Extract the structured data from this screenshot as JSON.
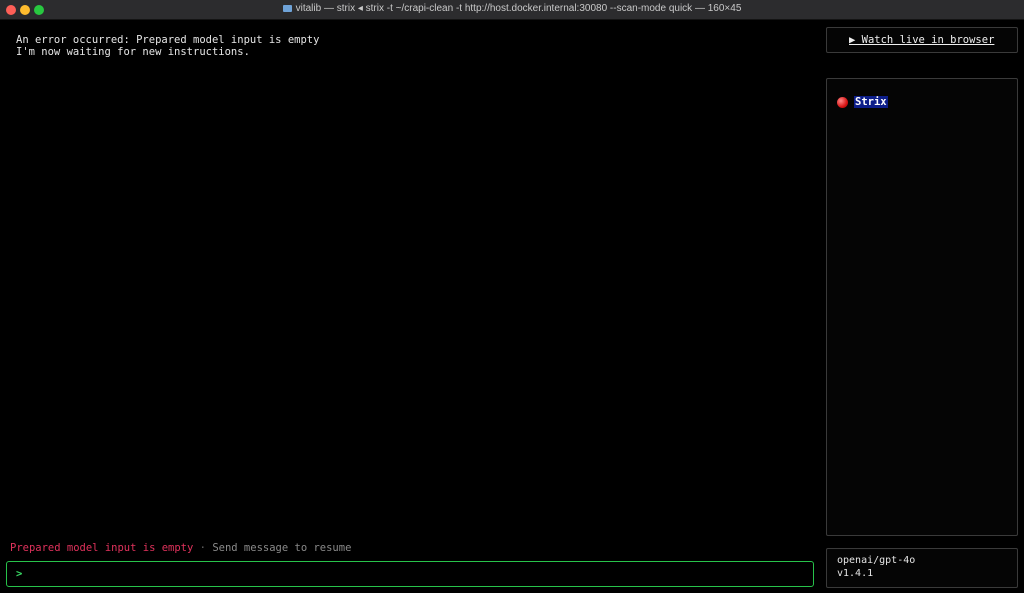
{
  "window": {
    "title": "vitalib — strix ◂ strix -t ~/crapi-clean -t http://host.docker.internal:30080 --scan-mode quick — 160×45"
  },
  "chat": {
    "messages": [
      "An error occurred: Prepared model input is empty",
      "I'm now waiting for new instructions."
    ]
  },
  "sidebar": {
    "watch_label": "▶ Watch live in browser",
    "agents": [
      {
        "label": "Strix"
      }
    ],
    "model": "openai/gpt-4o",
    "version": "v1.4.1"
  },
  "status_bar": {
    "error": "Prepared model input is empty",
    "separator": "·",
    "hint": "Send message to resume"
  },
  "input": {
    "prompt": ">",
    "value": ""
  }
}
